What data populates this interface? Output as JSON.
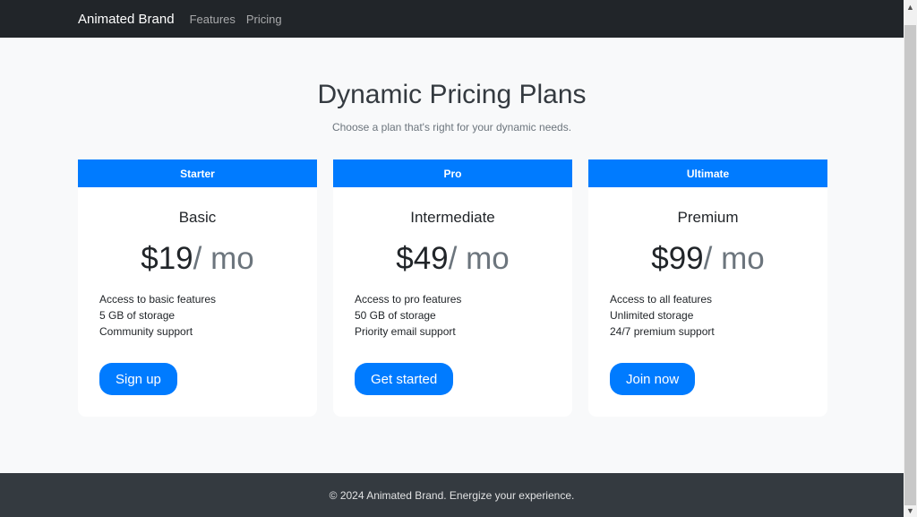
{
  "navbar": {
    "brand": "Animated Brand",
    "links": [
      "Features",
      "Pricing"
    ]
  },
  "hero": {
    "title": "Dynamic Pricing Plans",
    "subtitle": "Choose a plan that's right for your dynamic needs."
  },
  "plans": [
    {
      "header": "Starter",
      "title": "Basic",
      "price": "$19",
      "unit": "/ mo",
      "features": [
        "Access to basic features",
        "5 GB of storage",
        "Community support"
      ],
      "button": "Sign up"
    },
    {
      "header": "Pro",
      "title": "Intermediate",
      "price": "$49",
      "unit": "/ mo",
      "features": [
        "Access to pro features",
        "50 GB of storage",
        "Priority email support"
      ],
      "button": "Get started"
    },
    {
      "header": "Ultimate",
      "title": "Premium",
      "price": "$99",
      "unit": "/ mo",
      "features": [
        "Access to all features",
        "Unlimited storage",
        "24/7 premium support"
      ],
      "button": "Join now"
    }
  ],
  "footer": {
    "text": "© 2024 Animated Brand. Energize your experience."
  },
  "scrollbar": {
    "up_icon": "▲",
    "down_icon": "▼"
  },
  "colors": {
    "accent": "#007bff",
    "navbar_bg": "#212529",
    "footer_bg": "#343a40",
    "page_bg": "#f8f9fa"
  }
}
